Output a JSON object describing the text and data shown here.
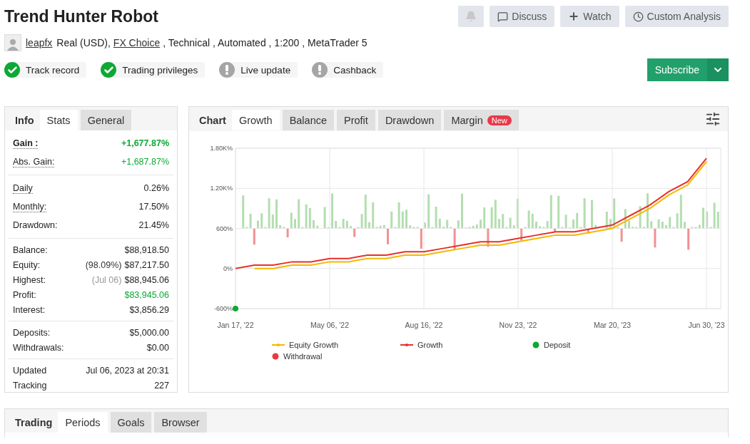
{
  "title": "Trend Hunter Robot",
  "header_buttons": [
    {
      "kind": "bell"
    },
    {
      "kind": "discuss",
      "label": "Discuss"
    },
    {
      "kind": "watch",
      "label": "Watch"
    },
    {
      "kind": "analysis",
      "label": "Custom Analysis"
    }
  ],
  "account": {
    "author": "leapfx",
    "parts": [
      {
        "text": "Real (USD),",
        "link": false
      },
      {
        "text": "FX Choice",
        "link": true
      },
      {
        "text": ", Technical , Automated , 1:200 , MetaTrader 5",
        "link": false
      }
    ]
  },
  "badges": [
    {
      "label": "Track record",
      "passed": true
    },
    {
      "label": "Trading privileges",
      "passed": true
    },
    {
      "label": "Live update",
      "passed": false
    },
    {
      "label": "Cashback",
      "passed": false
    }
  ],
  "subscribe": {
    "label": "Subscribe"
  },
  "stats_panel": {
    "title": "Info",
    "tabs": [
      {
        "label": "Stats",
        "selected": true
      },
      {
        "label": "General",
        "selected": false
      }
    ],
    "sections": [
      [
        {
          "label": "Gain :",
          "value": "+1,677.87%",
          "positive": true,
          "dotted": true,
          "bold": true
        },
        {
          "label": "Abs. Gain:",
          "value": "+1,687.87%",
          "positive": true,
          "dotted": true,
          "bold": false
        }
      ],
      [
        {
          "label": "Daily",
          "value": "0.26%",
          "positive": false,
          "dotted": true,
          "bold": false
        },
        {
          "label": "Monthly:",
          "value": "17.50%",
          "positive": false,
          "dotted": true,
          "bold": false
        },
        {
          "label": "Drawdown:",
          "value": "21.45%",
          "positive": false,
          "dotted": false,
          "bold": false
        }
      ],
      [
        {
          "label": "Balance:",
          "value": "$88,918.50",
          "positive": false,
          "dotted": false,
          "bold": false
        },
        {
          "label": "Equity:",
          "note": "(98.09%)",
          "note_muted": false,
          "value": "$87,217.50",
          "positive": false,
          "dotted": false,
          "bold": false
        },
        {
          "label": "Highest:",
          "note": "(Jul 06)",
          "note_muted": true,
          "value": "$88,945.06",
          "positive": false,
          "dotted": false,
          "bold": false
        },
        {
          "label": "Profit:",
          "value": "$83,945.06",
          "positive": true,
          "dotted": false,
          "bold": false
        },
        {
          "label": "Interest:",
          "value": "$3,856.29",
          "positive": false,
          "dotted": false,
          "bold": false
        }
      ],
      [
        {
          "label": "Deposits:",
          "value": "$5,000.00",
          "positive": false,
          "dotted": false,
          "bold": false
        },
        {
          "label": "Withdrawals:",
          "value": "$0.00",
          "positive": false,
          "dotted": false,
          "bold": false
        }
      ],
      [
        {
          "label": "Updated",
          "value": "Jul 06, 2023 at 20:31",
          "positive": false,
          "dotted": false,
          "bold": false
        },
        {
          "label": "Tracking",
          "value": "227",
          "positive": false,
          "dotted": false,
          "bold": false
        }
      ]
    ]
  },
  "chart_panel": {
    "title": "Chart",
    "tabs": [
      {
        "label": "Growth",
        "selected": true
      },
      {
        "label": "Balance",
        "selected": false
      },
      {
        "label": "Profit",
        "selected": false
      },
      {
        "label": "Drawdown",
        "selected": false
      },
      {
        "label": "Margin",
        "selected": false,
        "badge": "New"
      }
    ],
    "chart_data": {
      "type": "line",
      "grid": true,
      "legend": "bottom",
      "categories": [
        "Jan 17, '22",
        null,
        null,
        null,
        null,
        "May 06, '22",
        null,
        null,
        null,
        null,
        "Aug 16, '22",
        null,
        null,
        null,
        null,
        "Nov 23, '22",
        null,
        null,
        null,
        null,
        "Mar 20, '23",
        null,
        null,
        null,
        null,
        "Jun 30, '23"
      ],
      "ylim": [
        -600,
        1800
      ],
      "yticks": [
        {
          "value": -600,
          "label": "-600%"
        },
        {
          "value": 0,
          "label": "0%"
        },
        {
          "value": 600,
          "label": "600%"
        },
        {
          "value": 1200,
          "label": "1.20K%"
        },
        {
          "value": 1800,
          "label": "1.80K%"
        }
      ],
      "series": [
        {
          "name": "Equity Growth",
          "color": "#f5b800",
          "values": [
            null,
            0,
            0,
            50,
            50,
            100,
            100,
            150,
            150,
            200,
            200,
            250,
            300,
            350,
            350,
            400,
            450,
            500,
            500,
            550,
            600,
            750,
            900,
            1100,
            1250,
            1600
          ]
        },
        {
          "name": "Growth",
          "color": "#e8302a",
          "values": [
            0,
            50,
            50,
            100,
            100,
            150,
            150,
            200,
            200,
            250,
            250,
            300,
            350,
            400,
            400,
            450,
            500,
            550,
            550,
            600,
            650,
            800,
            950,
            1150,
            1300,
            1650
          ]
        },
        {
          "name": "Deposit",
          "color": "#0da934",
          "marker": "circle",
          "values": [
            -600,
            null,
            null,
            null,
            null,
            null,
            null,
            null,
            null,
            null,
            null,
            null,
            null,
            null,
            null,
            null,
            null,
            null,
            null,
            null,
            null,
            null,
            null,
            null,
            null,
            null
          ]
        },
        {
          "name": "Withdrawal",
          "color": "#e83c3c",
          "marker": "circle",
          "values": [
            null,
            null,
            null,
            null,
            null,
            null,
            null,
            null,
            null,
            null,
            null,
            null,
            null,
            null,
            null,
            null,
            null,
            null,
            null,
            null,
            null,
            null,
            null,
            null,
            null,
            null
          ]
        }
      ]
    }
  },
  "bottom_panel": {
    "title": "Trading",
    "tabs": [
      {
        "label": "Periods",
        "selected": true
      },
      {
        "label": "Goals",
        "selected": false
      },
      {
        "label": "Browser",
        "selected": false
      }
    ]
  }
}
